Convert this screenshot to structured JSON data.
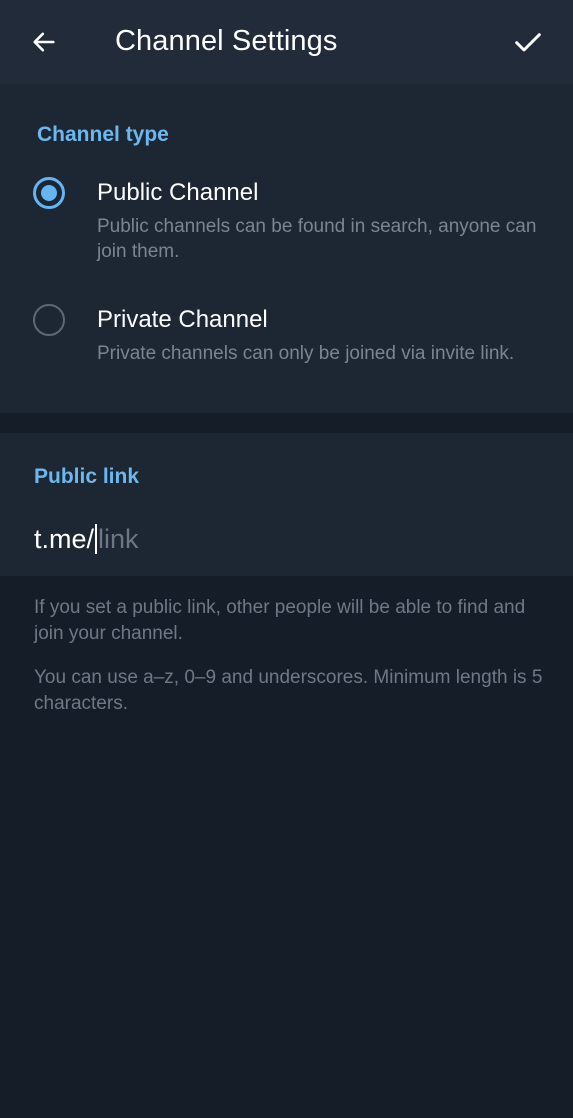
{
  "header": {
    "title": "Channel Settings",
    "back_icon": "arrow-left-icon",
    "confirm_icon": "check-icon"
  },
  "channel_type": {
    "heading": "Channel type",
    "options": [
      {
        "label": "Public Channel",
        "description": "Public channels can be found in search, anyone can join them.",
        "selected": true
      },
      {
        "label": "Private Channel",
        "description": "Private channels can only be joined via invite link.",
        "selected": false
      }
    ]
  },
  "public_link": {
    "heading": "Public link",
    "prefix": "t.me/",
    "value": "",
    "placeholder": "link"
  },
  "help": {
    "line1": "If you set a public link, other people will be able to find and join your channel.",
    "line2": "You can use a–z, 0–9 and underscores. Minimum length is 5 characters."
  },
  "colors": {
    "accent": "#64b5f3",
    "heading": "#6cb8ee",
    "header_bg": "#222b39",
    "section_bg": "#1d2633",
    "page_bg": "#151d28"
  }
}
